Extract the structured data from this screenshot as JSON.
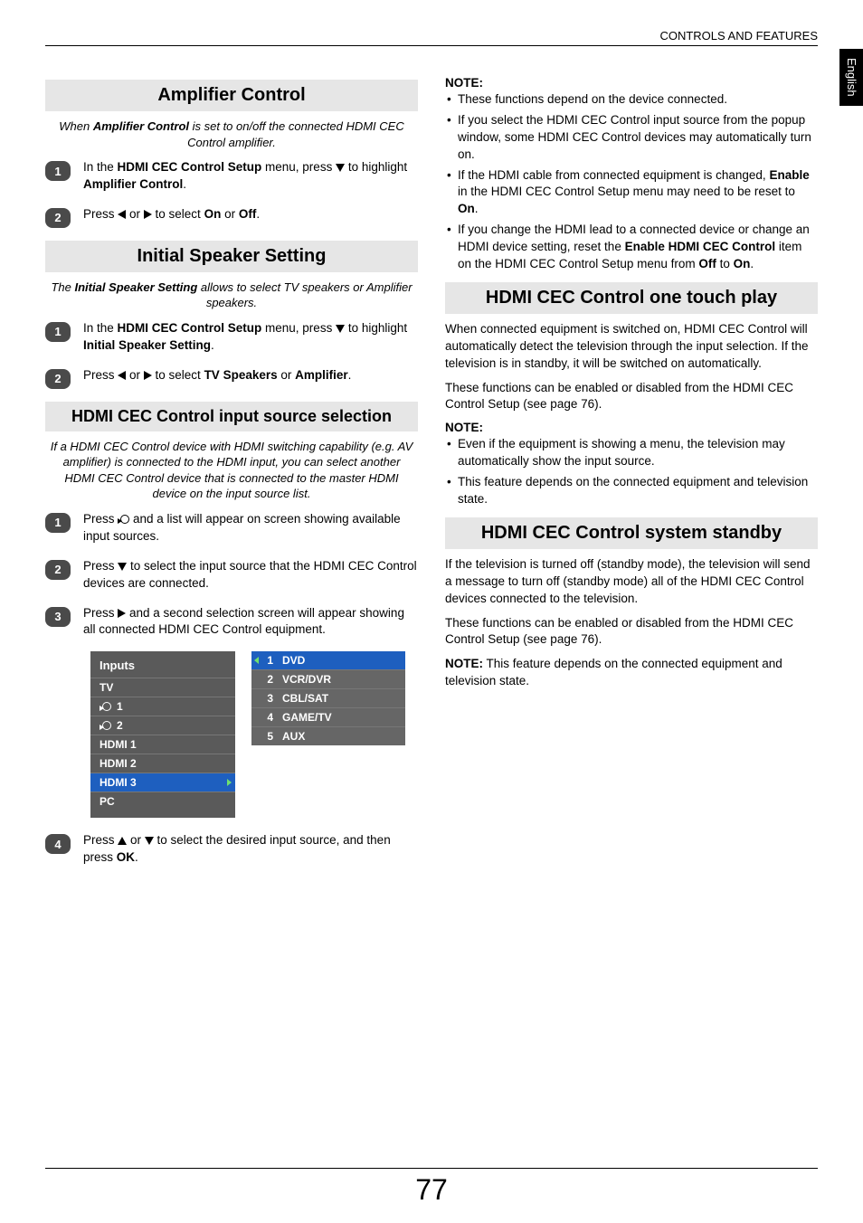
{
  "header": {
    "section": "CONTROLS AND FEATURES"
  },
  "lang_tab": "English",
  "page_number": "77",
  "left": {
    "amp": {
      "title": "Amplifier Control",
      "intro_pre": "When ",
      "intro_bold": "Amplifier Control",
      "intro_post": " is set to on/off the connected HDMI CEC Control amplifier.",
      "step1_a": "In the ",
      "step1_b": "HDMI CEC Control Setup",
      "step1_c": " menu, press ",
      "step1_d": " to highlight ",
      "step1_e": "Amplifier Control",
      "step2_a": "Press ",
      "step2_b": " or ",
      "step2_c": " to select ",
      "step2_d": "On",
      "step2_e": " or ",
      "step2_f": "Off"
    },
    "speaker": {
      "title": "Initial Speaker Setting",
      "intro_pre": "The ",
      "intro_b1": "Initial Speaker Setting",
      "intro_post": " allows to select TV speakers or Amplifier speakers.",
      "step1_a": "In the ",
      "step1_b": "HDMI CEC Control Setup",
      "step1_c": " menu, press ",
      "step1_d": " to highlight ",
      "step1_e": "Initial Speaker Setting",
      "step2_a": "Press ",
      "step2_b": " or ",
      "step2_c": " to select ",
      "step2_d": "TV Speakers",
      "step2_e": " or ",
      "step2_f": "Amplifier"
    },
    "srcsel": {
      "title": "HDMI CEC Control input source selection",
      "intro": "If a HDMI CEC Control  device with HDMI switching capability (e.g. AV amplifier) is connected to the HDMI input, you can select another HDMI CEC Control  device that is connected to the master HDMI device on the input source list.",
      "s1a": "Press ",
      "s1b": " and a list will appear on screen showing available input sources.",
      "s2a": "Press ",
      "s2b": " to select the input source that the HDMI CEC Control devices are connected.",
      "s3a": "Press ",
      "s3b": " and a second selection screen will appear showing all connected HDMI CEC Control equipment.",
      "s4a": "Press ",
      "s4b": " or ",
      "s4c": " to select the desired input source, and then press ",
      "s4d": "OK"
    },
    "inputs_panel": {
      "header": "Inputs",
      "rows": [
        "TV",
        "1",
        "2",
        "HDMI 1",
        "HDMI 2",
        "HDMI 3",
        "PC"
      ],
      "selected_index": 5
    },
    "submenu": {
      "items": [
        {
          "n": "1",
          "label": "DVD"
        },
        {
          "n": "2",
          "label": "VCR/DVR"
        },
        {
          "n": "3",
          "label": "CBL/SAT"
        },
        {
          "n": "4",
          "label": "GAME/TV"
        },
        {
          "n": "5",
          "label": "AUX"
        }
      ],
      "selected_index": 0
    }
  },
  "right": {
    "note1": {
      "label": "NOTE:",
      "bullets": [
        "These functions depend on the device connected.",
        "If you select the HDMI CEC Control input source from the popup window, some HDMI CEC Control devices may automatically turn on.",
        "",
        "",
        ""
      ],
      "b3_pre": "If the HDMI cable from connected equipment is changed, ",
      "b3_b": "Enable",
      "b3_mid": " in the HDMI CEC Control Setup menu may need to be reset to ",
      "b3_end": "On",
      "b4_pre": "If you change the HDMI lead to a connected device or change an HDMI device setting, reset the ",
      "b4_b": "Enable HDMI CEC Control",
      "b4_mid": " item on the HDMI CEC Control Setup menu from ",
      "b4_off": "Off",
      "b4_to": " to ",
      "b4_on": "On"
    },
    "onetouch": {
      "title": "HDMI CEC Control one touch play",
      "p1": "When connected equipment is switched on, HDMI CEC Control will automatically detect the television through the input selection. If the television is in standby, it will be switched on automatically.",
      "p2": "These functions can be enabled or disabled from the HDMI CEC Control Setup (see page 76).",
      "note_label": "NOTE:",
      "nb1": "Even if the equipment is showing a menu, the television may automatically show the input source.",
      "nb2": "This feature depends on the connected equipment and television state."
    },
    "standby": {
      "title": "HDMI CEC Control system standby",
      "p1": "If the television is turned off (standby mode), the television will send a message to turn off (standby mode) all of the HDMI CEC Control devices connected to the television.",
      "p2": "These functions can be enabled or disabled from the HDMI CEC Control Setup (see page 76).",
      "note_pre": "NOTE:",
      "note_body": " This feature depends on the connected equipment and television state."
    }
  }
}
